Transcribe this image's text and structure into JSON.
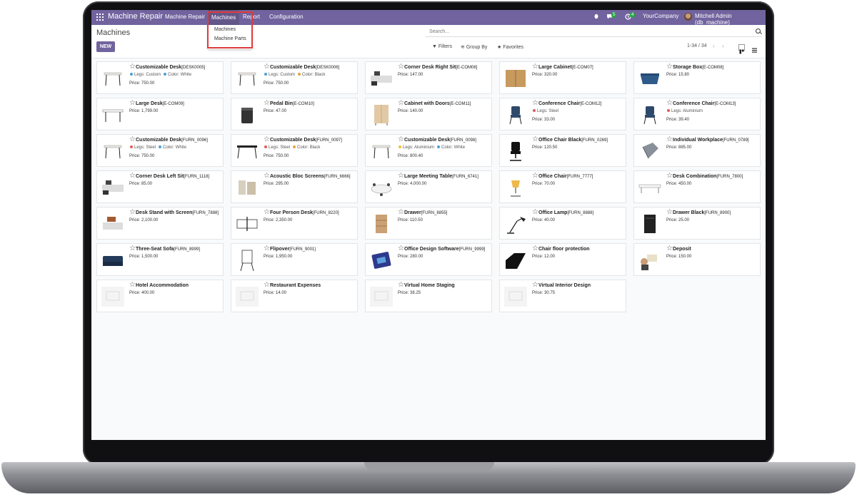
{
  "navbar": {
    "brand": "Machine Repair",
    "menus": [
      "Machine Repair",
      "Machines",
      "Report",
      "Configuration"
    ],
    "messages_count": "5",
    "activities_count": "4",
    "company": "YourCompany",
    "user": "Mitchell Admin (db_machine)"
  },
  "dropdown": {
    "items": [
      "Machines",
      "Machine Parts"
    ]
  },
  "control_panel": {
    "title": "Machines",
    "new_label": "NEW",
    "search_placeholder": "Search...",
    "filters_label": "Filters",
    "groupby_label": "Group By",
    "favorites_label": "Favorites",
    "pager": "1-34 / 34"
  },
  "cards": [
    {
      "name": "Customizable Desk",
      "ref": "[DESK0005]",
      "attrs": [
        {
          "text": "Legs: Custom",
          "color": "#4a9fd8"
        },
        {
          "text": "Color: White",
          "color": "#4a9fd8"
        }
      ],
      "price": "Price: 750.00",
      "img": "desk-white"
    },
    {
      "name": "Customizable Desk",
      "ref": "[DESK0006]",
      "attrs": [
        {
          "text": "Legs: Custom",
          "color": "#4a9fd8"
        },
        {
          "text": "Color: Black",
          "color": "#e8a33c"
        }
      ],
      "price": "Price: 750.00",
      "img": "desk-white"
    },
    {
      "name": "Corner Desk Right Sit",
      "ref": "[E-COM06]",
      "attrs": [],
      "price": "Price: 147.00",
      "img": "corner-desk"
    },
    {
      "name": "Large Cabinet",
      "ref": "[E-COM07]",
      "attrs": [],
      "price": "Price: 320.00",
      "img": "cabinet"
    },
    {
      "name": "Storage Box",
      "ref": "[E-COM08]",
      "attrs": [],
      "price": "Price: 15.80",
      "img": "storage-box"
    },
    {
      "name": "Large Desk",
      "ref": "[E-COM09]",
      "attrs": [],
      "price": "Price: 1,799.00",
      "img": "large-desk"
    },
    {
      "name": "Pedal Bin",
      "ref": "[E-COM10]",
      "attrs": [],
      "price": "Price: 47.00",
      "img": "bin"
    },
    {
      "name": "Cabinet with Doors",
      "ref": "[E-COM11]",
      "attrs": [],
      "price": "Price: 140.00",
      "img": "cabinet-doors"
    },
    {
      "name": "Conference Chair",
      "ref": "[E-COM12]",
      "attrs": [
        {
          "text": "Legs: Steel",
          "color": "#e05c5c"
        }
      ],
      "price": "Price: 33.00",
      "img": "chair-blue"
    },
    {
      "name": "Conference Chair",
      "ref": "[E-COM13]",
      "attrs": [
        {
          "text": "Legs: Aluminium",
          "color": "#e05c5c"
        }
      ],
      "price": "Price: 39.40",
      "img": "chair-blue"
    },
    {
      "name": "Customizable Desk",
      "ref": "[FURN_0096]",
      "attrs": [
        {
          "text": "Legs: Steel",
          "color": "#e05c5c"
        },
        {
          "text": "Color: White",
          "color": "#4a9fd8"
        }
      ],
      "price": "Price: 750.00",
      "img": "desk-white"
    },
    {
      "name": "Customizable Desk",
      "ref": "[FURN_0097]",
      "attrs": [
        {
          "text": "Legs: Steel",
          "color": "#e05c5c"
        },
        {
          "text": "Color: Black",
          "color": "#e8a33c"
        }
      ],
      "price": "Price: 750.00",
      "img": "desk-black"
    },
    {
      "name": "Customizable Desk",
      "ref": "[FURN_0098]",
      "attrs": [
        {
          "text": "Legs: Aluminium",
          "color": "#f0c030"
        },
        {
          "text": "Color: White",
          "color": "#4a9fd8"
        }
      ],
      "price": "Price: 800.40",
      "img": "desk-white"
    },
    {
      "name": "Office Chair Black",
      "ref": "[FURN_0269]",
      "attrs": [],
      "price": "Price: 120.50",
      "img": "office-chair"
    },
    {
      "name": "Individual Workplace",
      "ref": "[FURN_0789]",
      "attrs": [],
      "price": "Price: 885.00",
      "img": "workplace"
    },
    {
      "name": "Corner Desk Left Sit",
      "ref": "[FURN_1118]",
      "attrs": [],
      "price": "Price: 85.00",
      "img": "corner-desk"
    },
    {
      "name": "Acoustic Bloc Screens",
      "ref": "[FURN_6666]",
      "attrs": [],
      "price": "Price: 295.00",
      "img": "screens"
    },
    {
      "name": "Large Meeting Table",
      "ref": "[FURN_6741]",
      "attrs": [],
      "price": "Price: 4,000.00",
      "img": "meeting-table"
    },
    {
      "name": "Office Chair",
      "ref": "[FURN_7777]",
      "attrs": [],
      "price": "Price: 70.00",
      "img": "chair-yellow"
    },
    {
      "name": "Desk Combination",
      "ref": "[FURN_7800]",
      "attrs": [],
      "price": "Price: 450.00",
      "img": "desk-combo"
    },
    {
      "name": "Desk Stand with Screen",
      "ref": "[FURN_7888]",
      "attrs": [],
      "price": "Price: 2,100.00",
      "img": "desk-stand"
    },
    {
      "name": "Four Person Desk",
      "ref": "[FURN_8220]",
      "attrs": [],
      "price": "Price: 2,350.00",
      "img": "four-desk"
    },
    {
      "name": "Drawer",
      "ref": "[FURN_8855]",
      "attrs": [],
      "price": "Price: 110.50",
      "img": "drawer"
    },
    {
      "name": "Office Lamp",
      "ref": "[FURN_8888]",
      "attrs": [],
      "price": "Price: 40.00",
      "img": "lamp"
    },
    {
      "name": "Drawer Black",
      "ref": "[FURN_8900]",
      "attrs": [],
      "price": "Price: 25.00",
      "img": "drawer-black"
    },
    {
      "name": "Three-Seat Sofa",
      "ref": "[FURN_8999]",
      "attrs": [],
      "price": "Price: 1,500.00",
      "img": "sofa"
    },
    {
      "name": "Flipover",
      "ref": "[FURN_9001]",
      "attrs": [],
      "price": "Price: 1,950.00",
      "img": "flipover"
    },
    {
      "name": "Office Design Software",
      "ref": "[FURN_9999]",
      "attrs": [],
      "price": "Price: 280.00",
      "img": "software"
    },
    {
      "name": "Chair floor protection",
      "ref": "",
      "attrs": [],
      "price": "Price: 12.00",
      "img": "floor-mat"
    },
    {
      "name": "Deposit",
      "ref": "",
      "attrs": [],
      "price": "Price: 150.00",
      "img": "deposit"
    },
    {
      "name": "Hotel Accommodation",
      "ref": "",
      "attrs": [],
      "price": "Price: 400.00",
      "img": "placeholder"
    },
    {
      "name": "Restaurant Expenses",
      "ref": "",
      "attrs": [],
      "price": "Price: 14.00",
      "img": "placeholder"
    },
    {
      "name": "Virtual Home Staging",
      "ref": "",
      "attrs": [],
      "price": "Price: 38.25",
      "img": "placeholder"
    },
    {
      "name": "Virtual Interior Design",
      "ref": "",
      "attrs": [],
      "price": "Price: 30.75",
      "img": "placeholder"
    }
  ]
}
